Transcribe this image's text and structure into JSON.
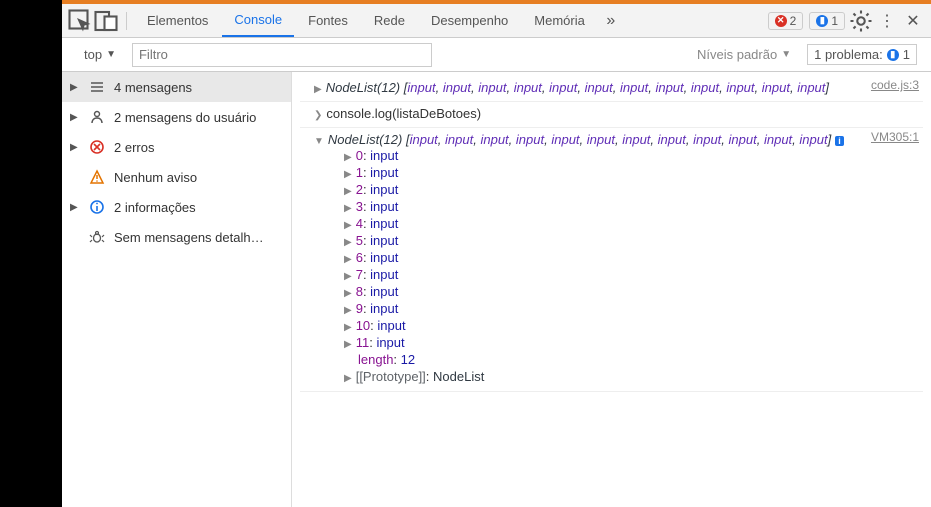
{
  "tabs": {
    "elements": "Elementos",
    "console": "Console",
    "sources": "Fontes",
    "network": "Rede",
    "performance": "Desempenho",
    "memory": "Memória"
  },
  "topBadges": {
    "errCount": "2",
    "infoCount": "1"
  },
  "toolbar": {
    "context": "top",
    "filter_placeholder": "Filtro",
    "levels": "Níveis padrão",
    "problems_label": "1 problema:",
    "problems_count": "1"
  },
  "sidebar": [
    {
      "key": "all",
      "label": "4 mensagens",
      "iconColor": "#555",
      "iconType": "list",
      "arrow": "▶"
    },
    {
      "key": "user",
      "label": "2 mensagens do usuário",
      "iconColor": "#555",
      "iconType": "user",
      "arrow": "▶"
    },
    {
      "key": "errors",
      "label": "2 erros",
      "iconColor": "#d93025",
      "iconType": "err",
      "arrow": "▶"
    },
    {
      "key": "warnings",
      "label": "Nenhum aviso",
      "iconColor": "#e37400",
      "iconType": "warn",
      "arrow": ""
    },
    {
      "key": "info",
      "label": "2 informações",
      "iconColor": "#1a73e8",
      "iconType": "info",
      "arrow": "▶"
    },
    {
      "key": "verbose",
      "label": "Sem mensagens detalh…",
      "iconColor": "#555",
      "iconType": "bug",
      "arrow": ""
    }
  ],
  "console": {
    "entry1": {
      "source": "code.js:3",
      "class": "NodeList",
      "count": "12",
      "items": [
        "input",
        "input",
        "input",
        "input",
        "input",
        "input",
        "input",
        "input",
        "input",
        "input",
        "input",
        "input"
      ]
    },
    "entry2": {
      "cmd": "console.log(listaDeBotoes)"
    },
    "entry3": {
      "source": "VM305:1",
      "class": "NodeList",
      "count": "12",
      "items": [
        "input",
        "input",
        "input",
        "input",
        "input",
        "input",
        "input",
        "input",
        "input",
        "input",
        "input",
        "input"
      ],
      "expandedProps": [
        {
          "key": "0",
          "val": "input"
        },
        {
          "key": "1",
          "val": "input"
        },
        {
          "key": "2",
          "val": "input"
        },
        {
          "key": "3",
          "val": "input"
        },
        {
          "key": "4",
          "val": "input"
        },
        {
          "key": "5",
          "val": "input"
        },
        {
          "key": "6",
          "val": "input"
        },
        {
          "key": "7",
          "val": "input"
        },
        {
          "key": "8",
          "val": "input"
        },
        {
          "key": "9",
          "val": "input"
        },
        {
          "key": "10",
          "val": "input"
        },
        {
          "key": "11",
          "val": "input"
        }
      ],
      "length": {
        "key": "length",
        "val": "12"
      },
      "proto": {
        "key": "[[Prototype]]",
        "val": "NodeList"
      }
    }
  }
}
